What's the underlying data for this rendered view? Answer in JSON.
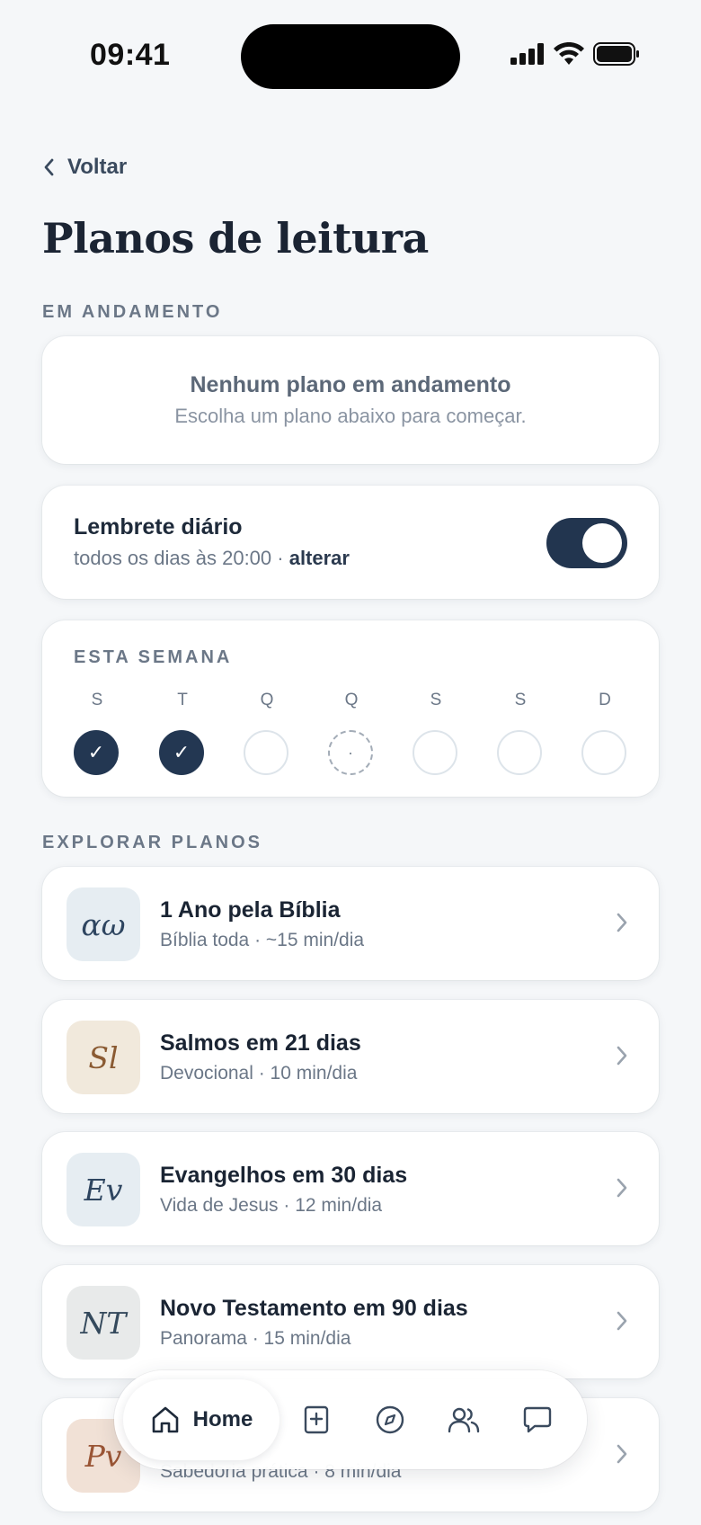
{
  "status": {
    "time": "09:41"
  },
  "nav": {
    "back_label": "Voltar"
  },
  "page": {
    "title": "Planos de leitura"
  },
  "in_progress": {
    "label": "EM ANDAMENTO",
    "empty_title": "Nenhum plano em andamento",
    "empty_sub": "Escolha um plano abaixo para começar."
  },
  "reminder": {
    "title": "Lembrete diário",
    "schedule": "todos os dias às 20:00 · ",
    "change_label": "alterar",
    "enabled": true
  },
  "week": {
    "label": "ESTA SEMANA",
    "days": [
      {
        "letter": "S",
        "state": "done",
        "mark": "✓"
      },
      {
        "letter": "T",
        "state": "done",
        "mark": "✓"
      },
      {
        "letter": "Q",
        "state": "empty",
        "mark": ""
      },
      {
        "letter": "Q",
        "state": "today",
        "mark": "·"
      },
      {
        "letter": "S",
        "state": "empty",
        "mark": ""
      },
      {
        "letter": "S",
        "state": "empty",
        "mark": ""
      },
      {
        "letter": "D",
        "state": "empty",
        "mark": ""
      }
    ]
  },
  "explore": {
    "label": "EXPLORAR PLANOS",
    "plans": [
      {
        "abbr": "αω",
        "title": "1 Ano pela Bíblia",
        "subtitle": "Bíblia toda · ~15 min/dia",
        "bg": "#e6edf2",
        "fg": "#2e4560"
      },
      {
        "abbr": "Sl",
        "title": "Salmos em 21 dias",
        "subtitle": "Devocional · 10 min/dia",
        "bg": "#f1e9dc",
        "fg": "#8a5a32"
      },
      {
        "abbr": "Ev",
        "title": "Evangelhos em 30 dias",
        "subtitle": "Vida de Jesus · 12 min/dia",
        "bg": "#e6edf2",
        "fg": "#2e4560"
      },
      {
        "abbr": "NT",
        "title": "Novo Testamento em 90 dias",
        "subtitle": "Panorama · 15 min/dia",
        "bg": "#e8eaea",
        "fg": "#34495c"
      },
      {
        "abbr": "Pv",
        "title": "",
        "subtitle": "Sabedoria prática · 8 min/dia",
        "bg": "#f1e1d6",
        "fg": "#9a5535"
      }
    ]
  },
  "tabbar": {
    "home_label": "Home",
    "icons": [
      "home-icon",
      "bible-add-icon",
      "compass-icon",
      "people-icon",
      "chat-icon"
    ]
  },
  "colors": {
    "accent": "#22354f",
    "background": "#f5f7f9"
  }
}
